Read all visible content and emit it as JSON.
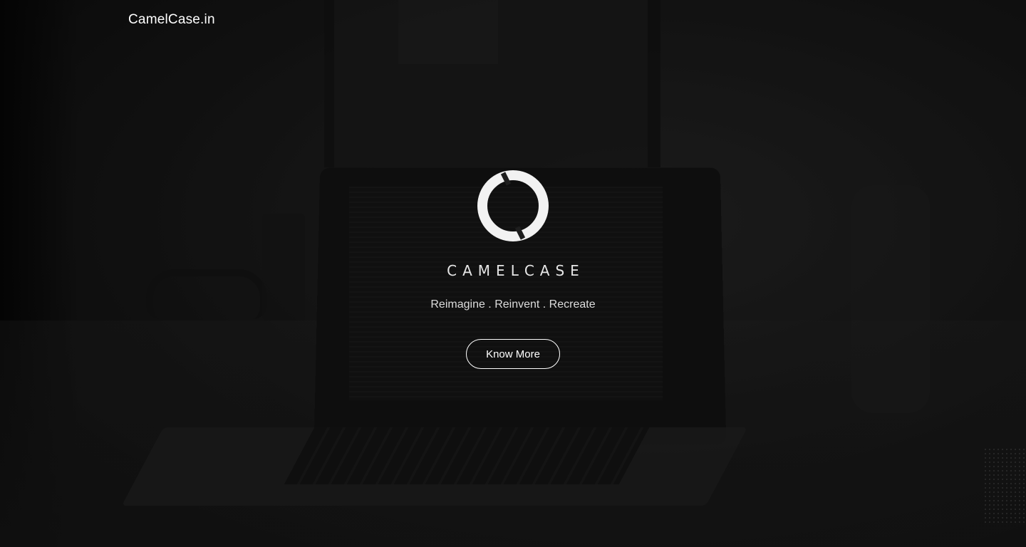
{
  "header": {
    "brand_link": "CamelCase.in"
  },
  "hero": {
    "logo_icon": "camelcase-ring-logo",
    "logo_wordmark": "CAMELCASE",
    "tagline": "Reimagine . Reinvent . Recreate",
    "cta_label": "Know More"
  },
  "colors": {
    "text": "#ffffff",
    "background": "#121212"
  }
}
